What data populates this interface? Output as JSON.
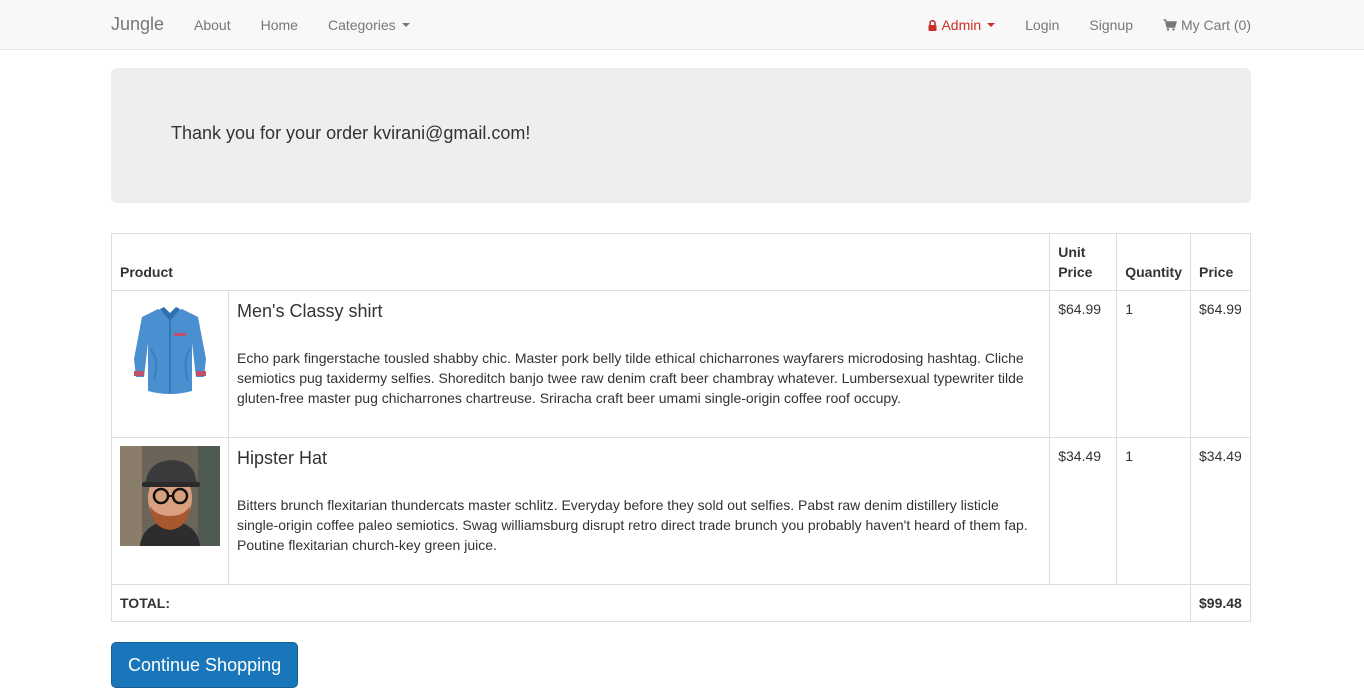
{
  "nav": {
    "brand": "Jungle",
    "left": [
      {
        "label": "About"
      },
      {
        "label": "Home"
      },
      {
        "label": "Categories"
      }
    ],
    "admin_label": "Admin",
    "login_label": "Login",
    "signup_label": "Signup",
    "cart_label": "My Cart (0)",
    "admin_color": "#c9302c"
  },
  "confirmation": {
    "message": "Thank you for your order kvirani@gmail.com!"
  },
  "table": {
    "headers": {
      "product": "Product",
      "unit_price": "Unit Price",
      "quantity": "Quantity",
      "price": "Price"
    },
    "rows": [
      {
        "name": "Men's Classy shirt",
        "description": "Echo park fingerstache tousled shabby chic. Master pork belly tilde ethical chicharrones wayfarers microdosing hashtag. Cliche semiotics pug taxidermy selfies. Shoreditch banjo twee raw denim craft beer chambray whatever. Lumbersexual typewriter tilde gluten-free master pug chicharrones chartreuse. Sriracha craft beer umami single-origin coffee roof occupy.",
        "unit_price": "$64.99",
        "quantity": "1",
        "price": "$64.99",
        "image": "blue-shirt-image"
      },
      {
        "name": "Hipster Hat",
        "description": "Bitters brunch flexitarian thundercats master schlitz. Everyday before they sold out selfies. Pabst raw denim distillery listicle single-origin coffee paleo semiotics. Swag williamsburg disrupt retro direct trade brunch you probably haven't heard of them fap. Poutine flexitarian church-key green juice.",
        "unit_price": "$34.49",
        "quantity": "1",
        "price": "$34.49",
        "image": "man-in-hat-image"
      }
    ],
    "total_label": "TOTAL:",
    "total_value": "$99.48"
  },
  "actions": {
    "continue_label": "Continue Shopping",
    "continue_color": "#1a76bb"
  }
}
